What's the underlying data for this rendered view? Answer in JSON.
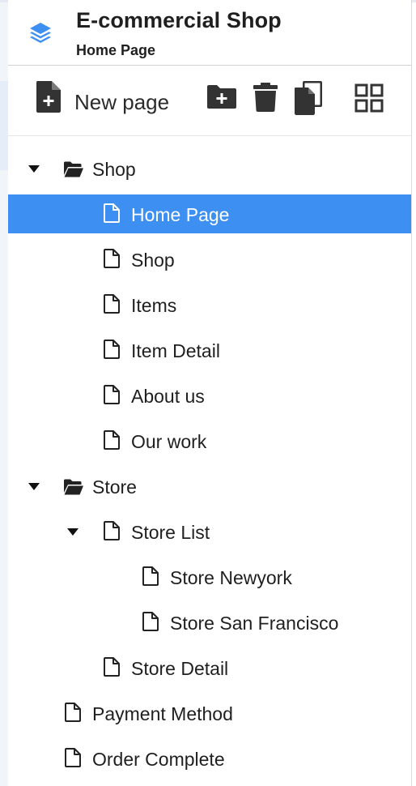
{
  "app": {
    "title": "E-commercial Shop",
    "subtitle": "Home Page",
    "logo_icon": "layers-icon",
    "accent_color": "#3d8ff2"
  },
  "toolbar": {
    "new_page_label": "New page",
    "buttons": [
      {
        "icon": "file-plus-icon",
        "label": "New page"
      },
      {
        "icon": "folder-plus-icon"
      },
      {
        "icon": "trash-icon"
      },
      {
        "icon": "copy-icon"
      },
      {
        "icon": "grid-icon"
      }
    ]
  },
  "tree": {
    "items": [
      {
        "label": "Shop",
        "type": "folder",
        "expanded": true,
        "level": 0
      },
      {
        "label": "Home Page",
        "type": "page",
        "level": 1,
        "selected": true
      },
      {
        "label": "Shop",
        "type": "page",
        "level": 1
      },
      {
        "label": "Items",
        "type": "page",
        "level": 1
      },
      {
        "label": "Item Detail",
        "type": "page",
        "level": 1
      },
      {
        "label": "About us",
        "type": "page",
        "level": 1
      },
      {
        "label": "Our work",
        "type": "page",
        "level": 1
      },
      {
        "label": "Store",
        "type": "folder",
        "expanded": true,
        "level": 0
      },
      {
        "label": "Store List",
        "type": "page",
        "expanded": true,
        "level": 1
      },
      {
        "label": "Store Newyork",
        "type": "page",
        "level": 2
      },
      {
        "label": "Store San Francisco",
        "type": "page",
        "level": 2
      },
      {
        "label": "Store Detail",
        "type": "page",
        "level": 1
      },
      {
        "label": "Payment Method",
        "type": "page",
        "level": 0
      },
      {
        "label": "Order Complete",
        "type": "page",
        "level": 0
      }
    ]
  }
}
